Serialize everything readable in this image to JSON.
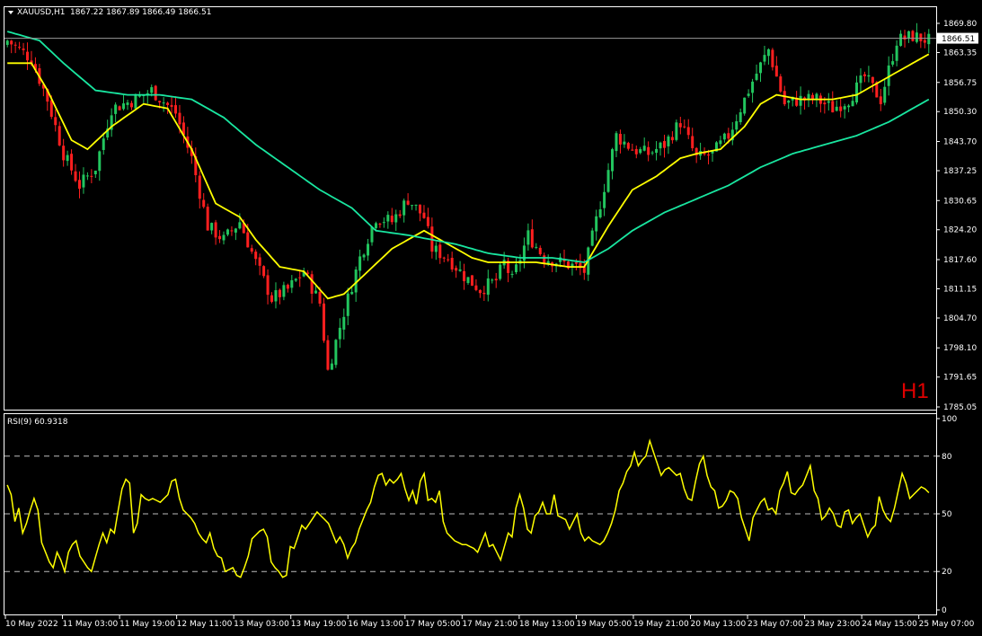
{
  "header": {
    "symbol_label": "XAUUSD,H1",
    "ohlc_label": "1867.22 1867.89 1866.49 1866.51"
  },
  "timeframe_badge": "H1",
  "rsi_header": "RSI(9) 60.9318",
  "colors": {
    "background": "#000000",
    "bull_candle": "#22c55e",
    "bear_candle": "#ff1f1f",
    "ma_fast": "#ffff00",
    "ma_slow": "#19e6a0",
    "rsi_line": "#ffff00",
    "axis": "#ffffff",
    "badge": "#e00000"
  },
  "chart_data": [
    {
      "type": "candlestick",
      "title": "XAUUSD,H1",
      "ylim": [
        1785.05,
        1869.8
      ],
      "y_ticks": [
        "1869.80",
        "1863.35",
        "1856.75",
        "1850.30",
        "1843.70",
        "1837.25",
        "1830.65",
        "1824.20",
        "1817.60",
        "1811.15",
        "1804.70",
        "1798.10",
        "1791.65",
        "1785.05"
      ],
      "x_ticks": [
        "10 May 2022",
        "11 May 03:00",
        "11 May 19:00",
        "12 May 11:00",
        "13 May 03:00",
        "13 May 19:00",
        "16 May 13:00",
        "17 May 05:00",
        "17 May 21:00",
        "18 May 13:00",
        "19 May 05:00",
        "19 May 21:00",
        "20 May 13:00",
        "23 May 07:00",
        "23 May 23:00",
        "24 May 15:00",
        "25 May 07:00"
      ],
      "current_price": "1866.51",
      "price_close_anchors": [
        [
          0,
          1866
        ],
        [
          6,
          1862
        ],
        [
          10,
          1853
        ],
        [
          14,
          1841
        ],
        [
          18,
          1834
        ],
        [
          22,
          1838
        ],
        [
          26,
          1851
        ],
        [
          32,
          1853
        ],
        [
          36,
          1855
        ],
        [
          42,
          1850
        ],
        [
          46,
          1840
        ],
        [
          50,
          1825
        ],
        [
          54,
          1822
        ],
        [
          58,
          1826
        ],
        [
          62,
          1817
        ],
        [
          66,
          1809
        ],
        [
          70,
          1811
        ],
        [
          74,
          1815
        ],
        [
          78,
          1808
        ],
        [
          80,
          1793
        ],
        [
          84,
          1806
        ],
        [
          88,
          1818
        ],
        [
          92,
          1827
        ],
        [
          96,
          1826
        ],
        [
          100,
          1831
        ],
        [
          104,
          1827
        ],
        [
          106,
          1820
        ],
        [
          110,
          1818
        ],
        [
          114,
          1814
        ],
        [
          118,
          1811
        ],
        [
          122,
          1813
        ],
        [
          124,
          1817
        ],
        [
          126,
          1813
        ],
        [
          130,
          1823
        ],
        [
          134,
          1818
        ],
        [
          138,
          1817
        ],
        [
          142,
          1816
        ],
        [
          144,
          1815
        ],
        [
          148,
          1830
        ],
        [
          152,
          1845
        ],
        [
          156,
          1842
        ],
        [
          160,
          1841
        ],
        [
          164,
          1843
        ],
        [
          168,
          1848
        ],
        [
          172,
          1840
        ],
        [
          176,
          1841
        ],
        [
          180,
          1845
        ],
        [
          184,
          1853
        ],
        [
          186,
          1857
        ],
        [
          190,
          1864
        ],
        [
          194,
          1852
        ],
        [
          198,
          1853
        ],
        [
          202,
          1853
        ],
        [
          206,
          1851
        ],
        [
          210,
          1853
        ],
        [
          214,
          1858
        ],
        [
          218,
          1853
        ],
        [
          222,
          1866
        ],
        [
          226,
          1867
        ],
        [
          230,
          1866
        ]
      ],
      "series": [
        {
          "name": "",
          "kind": "ma_fast",
          "anchors": [
            [
              0,
              1861
            ],
            [
              6,
              1861
            ],
            [
              10,
              1855
            ],
            [
              16,
              1844
            ],
            [
              20,
              1842
            ],
            [
              26,
              1847
            ],
            [
              34,
              1852
            ],
            [
              40,
              1851
            ],
            [
              46,
              1842
            ],
            [
              52,
              1830
            ],
            [
              58,
              1827
            ],
            [
              62,
              1822
            ],
            [
              68,
              1816
            ],
            [
              74,
              1815
            ],
            [
              80,
              1809
            ],
            [
              84,
              1810
            ],
            [
              90,
              1815
            ],
            [
              96,
              1820
            ],
            [
              100,
              1822
            ],
            [
              104,
              1824
            ],
            [
              110,
              1821
            ],
            [
              116,
              1818
            ],
            [
              120,
              1817
            ],
            [
              126,
              1817
            ],
            [
              132,
              1817
            ],
            [
              140,
              1816
            ],
            [
              144,
              1816
            ],
            [
              150,
              1825
            ],
            [
              156,
              1833
            ],
            [
              162,
              1836
            ],
            [
              168,
              1840
            ],
            [
              172,
              1841
            ],
            [
              178,
              1842
            ],
            [
              184,
              1847
            ],
            [
              188,
              1852
            ],
            [
              192,
              1854
            ],
            [
              198,
              1853
            ],
            [
              206,
              1853
            ],
            [
              212,
              1854
            ],
            [
              218,
              1857
            ],
            [
              224,
              1860
            ],
            [
              230,
              1863
            ]
          ]
        },
        {
          "name": "",
          "kind": "ma_slow",
          "anchors": [
            [
              0,
              1868
            ],
            [
              8,
              1866
            ],
            [
              14,
              1861
            ],
            [
              22,
              1855
            ],
            [
              30,
              1854
            ],
            [
              38,
              1854
            ],
            [
              46,
              1853
            ],
            [
              54,
              1849
            ],
            [
              62,
              1843
            ],
            [
              70,
              1838
            ],
            [
              78,
              1833
            ],
            [
              86,
              1829
            ],
            [
              92,
              1824
            ],
            [
              100,
              1823
            ],
            [
              106,
              1822
            ],
            [
              112,
              1821
            ],
            [
              120,
              1819
            ],
            [
              128,
              1818
            ],
            [
              136,
              1818
            ],
            [
              144,
              1817
            ],
            [
              150,
              1820
            ],
            [
              156,
              1824
            ],
            [
              164,
              1828
            ],
            [
              172,
              1831
            ],
            [
              180,
              1834
            ],
            [
              188,
              1838
            ],
            [
              196,
              1841
            ],
            [
              204,
              1843
            ],
            [
              212,
              1845
            ],
            [
              220,
              1848
            ],
            [
              230,
              1853
            ]
          ]
        }
      ]
    },
    {
      "type": "line",
      "title": "RSI(9) 60.9318",
      "ylim": [
        0,
        100
      ],
      "y_ticks": [
        "100",
        "80",
        "50",
        "20",
        "0"
      ],
      "levels": [
        20,
        50,
        80
      ],
      "series": [
        {
          "name": "",
          "values": [
            65,
            60,
            46,
            53,
            40,
            45,
            52,
            58,
            52,
            35,
            30,
            25,
            22,
            30,
            26,
            20,
            30,
            34,
            36,
            28,
            25,
            22,
            20,
            27,
            34,
            40,
            35,
            42,
            40,
            52,
            63,
            68,
            66,
            40,
            45,
            60,
            58,
            57,
            58,
            57,
            56,
            58,
            60,
            67,
            68,
            58,
            52,
            50,
            48,
            45,
            40,
            37,
            35,
            40,
            32,
            28,
            27,
            20,
            21,
            22,
            18,
            17,
            22,
            28,
            37,
            39,
            41,
            42,
            38,
            25,
            22,
            20,
            17,
            18,
            33,
            32,
            38,
            44,
            42,
            45,
            48,
            51,
            49,
            47,
            45,
            40,
            35,
            38,
            34,
            27,
            32,
            35,
            42,
            47,
            52,
            56,
            64,
            70,
            71,
            65,
            68,
            66,
            68,
            71,
            63,
            57,
            62,
            55,
            67,
            71,
            57,
            58,
            56,
            62,
            46,
            40,
            38,
            36,
            35,
            34,
            34,
            33,
            32,
            30,
            35,
            40,
            33,
            34,
            30,
            26,
            33,
            40,
            38,
            53,
            60,
            53,
            42,
            40,
            49,
            51,
            56,
            50,
            50,
            60,
            49,
            48,
            47,
            42,
            46,
            50,
            40,
            36,
            38,
            36,
            35,
            34,
            36,
            40,
            45,
            52,
            62,
            66,
            72,
            75,
            82,
            75,
            78,
            80,
            88,
            82,
            76,
            70,
            73,
            74,
            72,
            70,
            71,
            63,
            58,
            57,
            67,
            76,
            80,
            70,
            64,
            62,
            53,
            54,
            57,
            62,
            61,
            58,
            48,
            42,
            36,
            48,
            52,
            56,
            58,
            52,
            53,
            50,
            62,
            66,
            72,
            61,
            60,
            63,
            65,
            70,
            75,
            62,
            58,
            47,
            49,
            53,
            50,
            44,
            43,
            51,
            52,
            45,
            48,
            50,
            44,
            38,
            42,
            44,
            59,
            52,
            48,
            46,
            53,
            62,
            71,
            66,
            58,
            60,
            62,
            64,
            63,
            61
          ]
        }
      ]
    }
  ]
}
